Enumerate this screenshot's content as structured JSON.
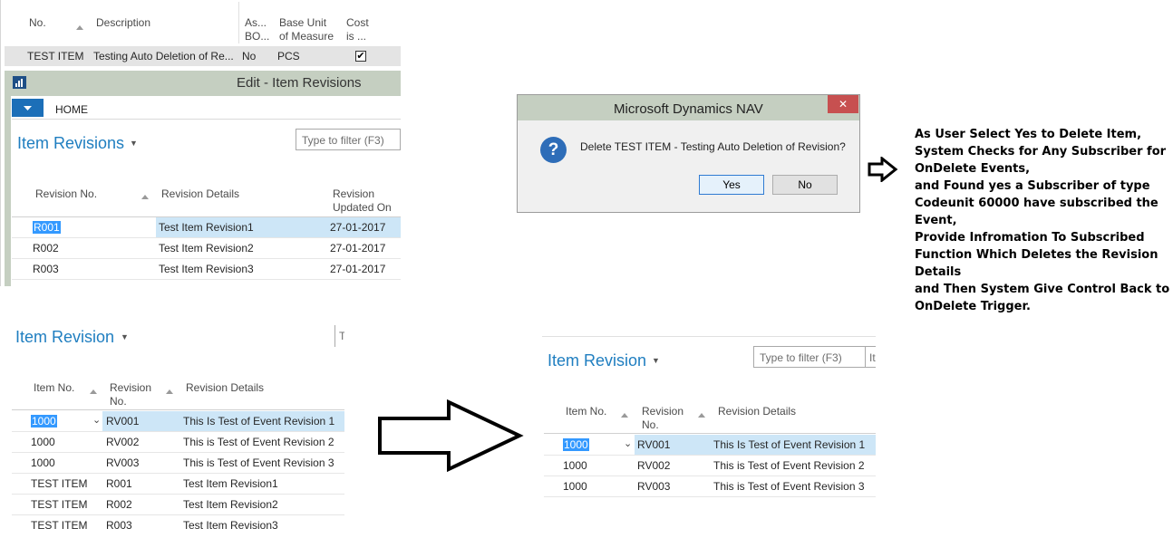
{
  "item_grid": {
    "headers": {
      "no": "No.",
      "description": "Description",
      "assembly_bom": [
        "As...",
        "BO..."
      ],
      "base_unit": [
        "Base Unit",
        "of Measure"
      ],
      "cost": [
        "Cost",
        "is ..."
      ]
    },
    "row": {
      "no": "TEST ITEM",
      "description": "Testing Auto Deletion of Re...",
      "assembly_bom": "No",
      "base_unit": "PCS",
      "cost_checked": true
    }
  },
  "edit_window": {
    "title": "Edit - Item Revisions",
    "home_tab": "HOME",
    "page_title": "Item Revisions",
    "filter_placeholder": "Type to filter (F3)",
    "headers": {
      "revision_no": "Revision No.",
      "revision_details": "Revision Details",
      "updated_on": [
        "Revision",
        "Updated On"
      ]
    },
    "rows": [
      {
        "revision_no": "R001",
        "details": "Test Item Revision1",
        "date": "27-01-2017"
      },
      {
        "revision_no": "R002",
        "details": "Test Item Revision2",
        "date": "27-01-2017"
      },
      {
        "revision_no": "R003",
        "details": "Test Item Revision3",
        "date": "27-01-2017"
      }
    ]
  },
  "dialog": {
    "title": "Microsoft Dynamics NAV",
    "close": "✕",
    "message": "Delete TEST ITEM - Testing Auto Deletion of Revision?",
    "yes": "Yes",
    "no": "No"
  },
  "note_lines": [
    "As User Select Yes to Delete Item,",
    "System Checks for Any Subscriber for",
    "OnDelete Events,",
    "and Found yes a Subscriber of type",
    "Codeunit 60000 have subscribed the",
    "Event,",
    "Provide Infromation To Subscribed",
    "Function Which Deletes the Revision",
    "Details",
    "and Then System Give Control Back to",
    "OnDelete Trigger."
  ],
  "revision_before": {
    "page_title": "Item Revision",
    "filter_stub": "T",
    "headers": {
      "item_no": "Item No.",
      "revision_no": [
        "Revision",
        "No."
      ],
      "revision_details": "Revision Details"
    },
    "rows": [
      {
        "item_no": "1000",
        "revision_no": "RV001",
        "details": "This Is Test of Event Revision 1"
      },
      {
        "item_no": "1000",
        "revision_no": "RV002",
        "details": "This is Test of Event Revision 2"
      },
      {
        "item_no": "1000",
        "revision_no": "RV003",
        "details": "This is Test of Event Revision 3"
      },
      {
        "item_no": "TEST ITEM",
        "revision_no": "R001",
        "details": "Test Item Revision1"
      },
      {
        "item_no": "TEST ITEM",
        "revision_no": "R002",
        "details": "Test Item Revision2"
      },
      {
        "item_no": "TEST ITEM",
        "revision_no": "R003",
        "details": "Test Item Revision3"
      }
    ]
  },
  "revision_after": {
    "page_title": "Item Revision",
    "filter_placeholder": "Type to filter (F3)",
    "filter_stub": "It",
    "headers": {
      "item_no": "Item No.",
      "revision_no": [
        "Revision",
        "No."
      ],
      "revision_details": "Revision Details"
    },
    "rows": [
      {
        "item_no": "1000",
        "revision_no": "RV001",
        "details": "This Is Test of Event Revision 1"
      },
      {
        "item_no": "1000",
        "revision_no": "RV002",
        "details": "This is Test of Event Revision 2"
      },
      {
        "item_no": "1000",
        "revision_no": "RV003",
        "details": "This is Test of Event Revision 3"
      }
    ]
  },
  "colors": {
    "nav_green": "#c5cfc1",
    "accent_blue": "#1f7ec0",
    "selection": "#cde6f7",
    "close_red": "#c75050"
  }
}
